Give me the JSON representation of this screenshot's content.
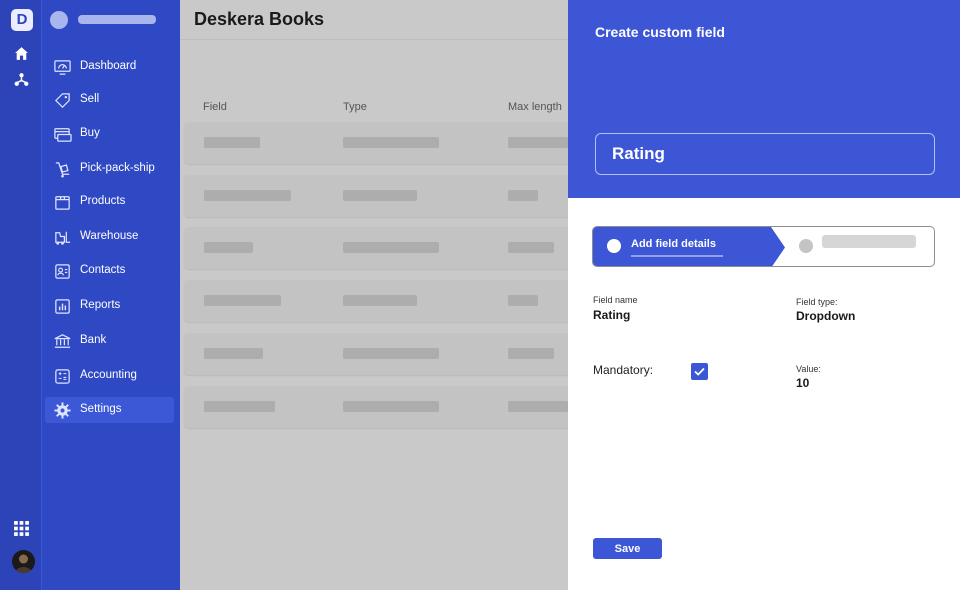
{
  "rail": {
    "logo_letter": "D",
    "icons": [
      "home-icon",
      "network-icon",
      "apps-grid-icon",
      "avatar"
    ]
  },
  "sidebar": {
    "items": [
      {
        "label": "Dashboard",
        "icon": "dashboard-icon"
      },
      {
        "label": "Sell",
        "icon": "tag-icon"
      },
      {
        "label": "Buy",
        "icon": "card-icon"
      },
      {
        "label": "Pick-pack-ship",
        "icon": "trolley-icon"
      },
      {
        "label": "Products",
        "icon": "box-icon"
      },
      {
        "label": "Warehouse",
        "icon": "forklift-icon"
      },
      {
        "label": "Contacts",
        "icon": "contact-card-icon"
      },
      {
        "label": "Reports",
        "icon": "chart-icon"
      },
      {
        "label": "Bank",
        "icon": "bank-icon"
      },
      {
        "label": "Accounting",
        "icon": "calculator-icon"
      },
      {
        "label": "Settings",
        "icon": "gear-icon",
        "active": true
      }
    ]
  },
  "main": {
    "title": "Deskera Books",
    "columns": [
      "Field",
      "Type",
      "Max length"
    ]
  },
  "drawer": {
    "title": "Create custom field",
    "field_name_display": "Rating",
    "steps": [
      {
        "label": "Add field details",
        "active": true
      },
      {
        "label": "",
        "active": false
      }
    ],
    "field_name_label": "Field name",
    "field_name_value": "Rating",
    "field_type_label": "Field type:",
    "field_type_value": "Dropdown",
    "mandatory_label": "Mandatory:",
    "mandatory_checked": true,
    "value_label": "Value:",
    "value_value": "10",
    "save_label": "Save"
  },
  "colors": {
    "primary": "#3c56d6",
    "sidebar": "#2f49c4",
    "rail": "#2c44b8",
    "overlay_bg": "#c9c9c9"
  }
}
